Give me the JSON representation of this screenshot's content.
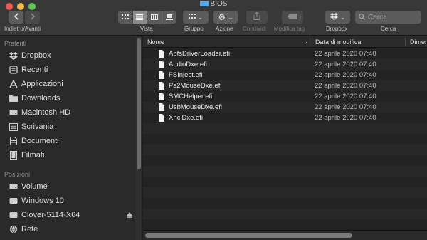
{
  "window": {
    "title": "BIOS"
  },
  "toolbar": {
    "nav_label": "Indietro/Avanti",
    "view_label": "Vista",
    "group_label": "Gruppo",
    "action_label": "Azione",
    "share_label": "Condividi",
    "tag_label": "Modifica tag",
    "dropbox_label": "Dropbox",
    "search_label": "Cerca",
    "search_placeholder": "Cerca",
    "active_view": "list"
  },
  "sidebar": {
    "favorites_header": "Preferiti",
    "favorites": [
      {
        "label": "Dropbox",
        "icon": "dropbox-icon"
      },
      {
        "label": "Recenti",
        "icon": "recents-icon"
      },
      {
        "label": "Applicazioni",
        "icon": "applications-icon"
      },
      {
        "label": "Downloads",
        "icon": "folder-icon"
      },
      {
        "label": "Macintosh HD",
        "icon": "harddisk-icon"
      },
      {
        "label": "Scrivania",
        "icon": "desktop-icon"
      },
      {
        "label": "Documenti",
        "icon": "document-icon"
      },
      {
        "label": "Filmati",
        "icon": "movies-icon"
      }
    ],
    "locations_header": "Posizioni",
    "locations": [
      {
        "label": "Volume",
        "icon": "disk-icon"
      },
      {
        "label": "Windows 10",
        "icon": "disk-icon"
      },
      {
        "label": "Clover-5114-X64",
        "icon": "disk-icon"
      },
      {
        "label": "Rete",
        "icon": "network-icon"
      }
    ]
  },
  "filelist": {
    "columns": {
      "name": "Nome",
      "date": "Data di modifica",
      "size": "Dimen"
    },
    "rows": [
      {
        "name": "ApfsDriverLoader.efi",
        "date": "22 aprile 2020 07:40"
      },
      {
        "name": "AudioDxe.efi",
        "date": "22 aprile 2020 07:40"
      },
      {
        "name": "FSInject.efi",
        "date": "22 aprile 2020 07:40"
      },
      {
        "name": "Ps2MouseDxe.efi",
        "date": "22 aprile 2020 07:40"
      },
      {
        "name": "SMCHelper.efi",
        "date": "22 aprile 2020 07:40"
      },
      {
        "name": "UsbMouseDxe.efi",
        "date": "22 aprile 2020 07:40"
      },
      {
        "name": "XhciDxe.efi",
        "date": "22 aprile 2020 07:40"
      }
    ]
  },
  "colors": {
    "folder_blue": "#57a9e8",
    "sidebar_bg": "#2a2a2a",
    "list_bg": "#1e1e1e"
  }
}
